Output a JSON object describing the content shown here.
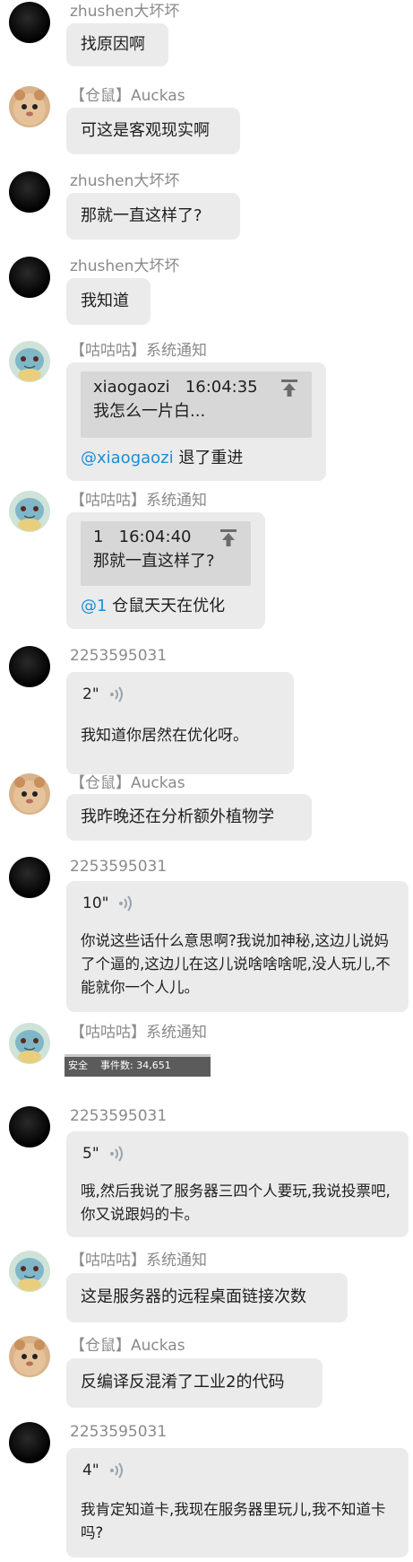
{
  "messages": [
    {
      "sender": "zhushen大坏坏",
      "text": "找原因啊"
    },
    {
      "sender": "【仓鼠】Auckas",
      "text": "可这是客观现实啊"
    },
    {
      "sender": "zhushen大坏坏",
      "text": "那就一直这样了?"
    },
    {
      "sender": "zhushen大坏坏",
      "text": "我知道"
    },
    {
      "sender": "【咕咕咕】系统通知",
      "quote": {
        "user": "xiaogaozi",
        "time": "16:04:35",
        "text": "我怎么一片白..."
      },
      "mention": "@xiaogaozi",
      "text": " 退了重进"
    },
    {
      "sender": "【咕咕咕】系统通知",
      "quote": {
        "user": "1",
        "time": "16:04:40",
        "text": "那就一直这样了?"
      },
      "mention": "@1",
      "text": " 仓鼠天天在优化"
    },
    {
      "sender": "2253595031",
      "voice": "2\"",
      "text": "我知道你居然在优化呀。"
    },
    {
      "sender": "【仓鼠】Auckas",
      "text": "我昨晚还在分析额外植物学"
    },
    {
      "sender": "2253595031",
      "voice": "10\"",
      "text": "你说这些话什么意思啊?我说加神秘,这边儿说妈了个逼的,这边儿在这儿说啥啥啥呢,没人玩儿,不能就你一个人儿。"
    },
    {
      "sender": "【咕咕咕】系统通知",
      "screenshot": {
        "label": "安全",
        "events": "事件数: 34,651"
      }
    },
    {
      "sender": "2253595031",
      "voice": "5\"",
      "text": "哦,然后我说了服务器三四个人要玩,我说投票吧,你又说跟妈的卡。"
    },
    {
      "sender": "【咕咕咕】系统通知",
      "text": "这是服务器的远程桌面链接次数"
    },
    {
      "sender": "【仓鼠】Auckas",
      "text": "反编译反混淆了工业2的代码"
    },
    {
      "sender": "2253595031",
      "voice": "4\"",
      "text": "我肯定知道卡,我现在服务器里玩儿,我不知道卡吗?"
    }
  ],
  "colors": {
    "bubble": "#ebebeb",
    "mention": "#1a8fd6",
    "sender": "#8a8a8a"
  },
  "icons": {
    "quote": "arrow-up-bar-icon",
    "voice": "sound-wave-icon"
  }
}
